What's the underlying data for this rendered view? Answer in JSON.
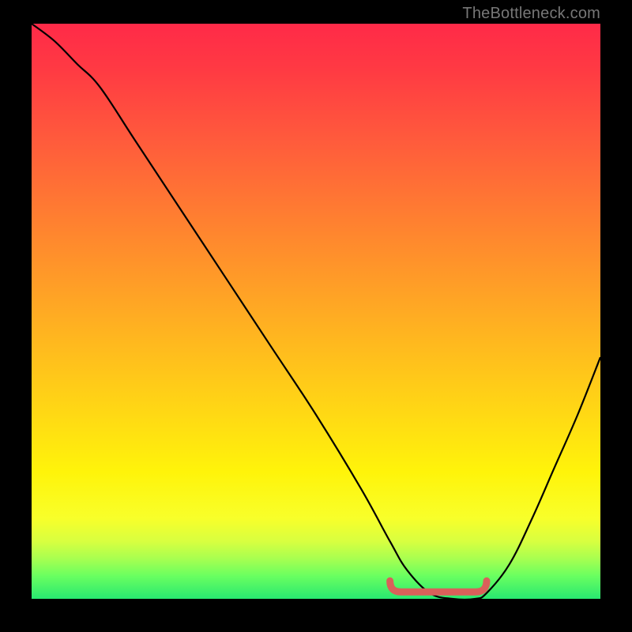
{
  "attribution": "TheBottleneck.com",
  "chart_data": {
    "type": "line",
    "title": "",
    "xlabel": "",
    "ylabel": "",
    "xlim": [
      0,
      100
    ],
    "ylim": [
      0,
      100
    ],
    "grid": false,
    "legend": false,
    "series": [
      {
        "name": "bottleneck-curve",
        "x": [
          0,
          4,
          8,
          12,
          18,
          26,
          34,
          42,
          50,
          58,
          63,
          66,
          70,
          74,
          78,
          80,
          84,
          88,
          92,
          96,
          100
        ],
        "y": [
          100,
          97,
          93,
          89,
          80,
          68,
          56,
          44,
          32,
          19,
          10,
          5,
          1,
          0,
          0,
          1,
          6,
          14,
          23,
          32,
          42
        ]
      }
    ],
    "annotations": [
      {
        "name": "optimal-range-highlight",
        "type": "segment",
        "x": [
          63,
          80
        ],
        "y": [
          1.2,
          1.2
        ],
        "color": "#d9605a"
      }
    ],
    "gradient_stops": [
      {
        "pos": 0,
        "color": "#ff2a48"
      },
      {
        "pos": 50,
        "color": "#ff9a28"
      },
      {
        "pos": 80,
        "color": "#fff40a"
      },
      {
        "pos": 100,
        "color": "#28e870"
      }
    ]
  }
}
